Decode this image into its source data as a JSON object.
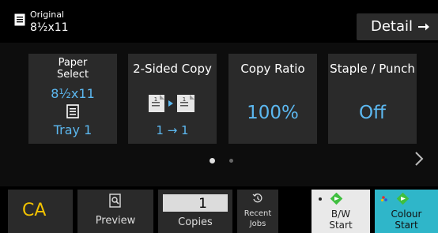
{
  "header": {
    "original_label": "Original",
    "original_size": "8½x11",
    "detail_label": "Detail"
  },
  "tiles": [
    {
      "title_line1": "Paper",
      "title_line2": "Select",
      "value_line1": "8½x11",
      "value_line2": "Tray 1",
      "icon": "document-icon"
    },
    {
      "title": "2-Sided Copy",
      "value": "1 → 1",
      "icon": "two-sided-copy-icon"
    },
    {
      "title": "Copy Ratio",
      "value": "100%"
    },
    {
      "title": "Staple / Punch",
      "value": "Off"
    }
  ],
  "pagination": {
    "current": 1,
    "total": 2
  },
  "bottom": {
    "ca_label": "CA",
    "preview_label": "Preview",
    "copies_value": "1",
    "copies_label": "Copies",
    "recent_line1": "Recent",
    "recent_line2": "Jobs",
    "bw_line1": "B/W",
    "bw_line2": "Start",
    "colour_line1": "Colour",
    "colour_line2": "Start"
  },
  "colors": {
    "accent_blue": "#5cb8f0",
    "ca_yellow": "#f2c200",
    "colour_start": "#2fb6c9",
    "start_green": "#3fbf3f"
  }
}
